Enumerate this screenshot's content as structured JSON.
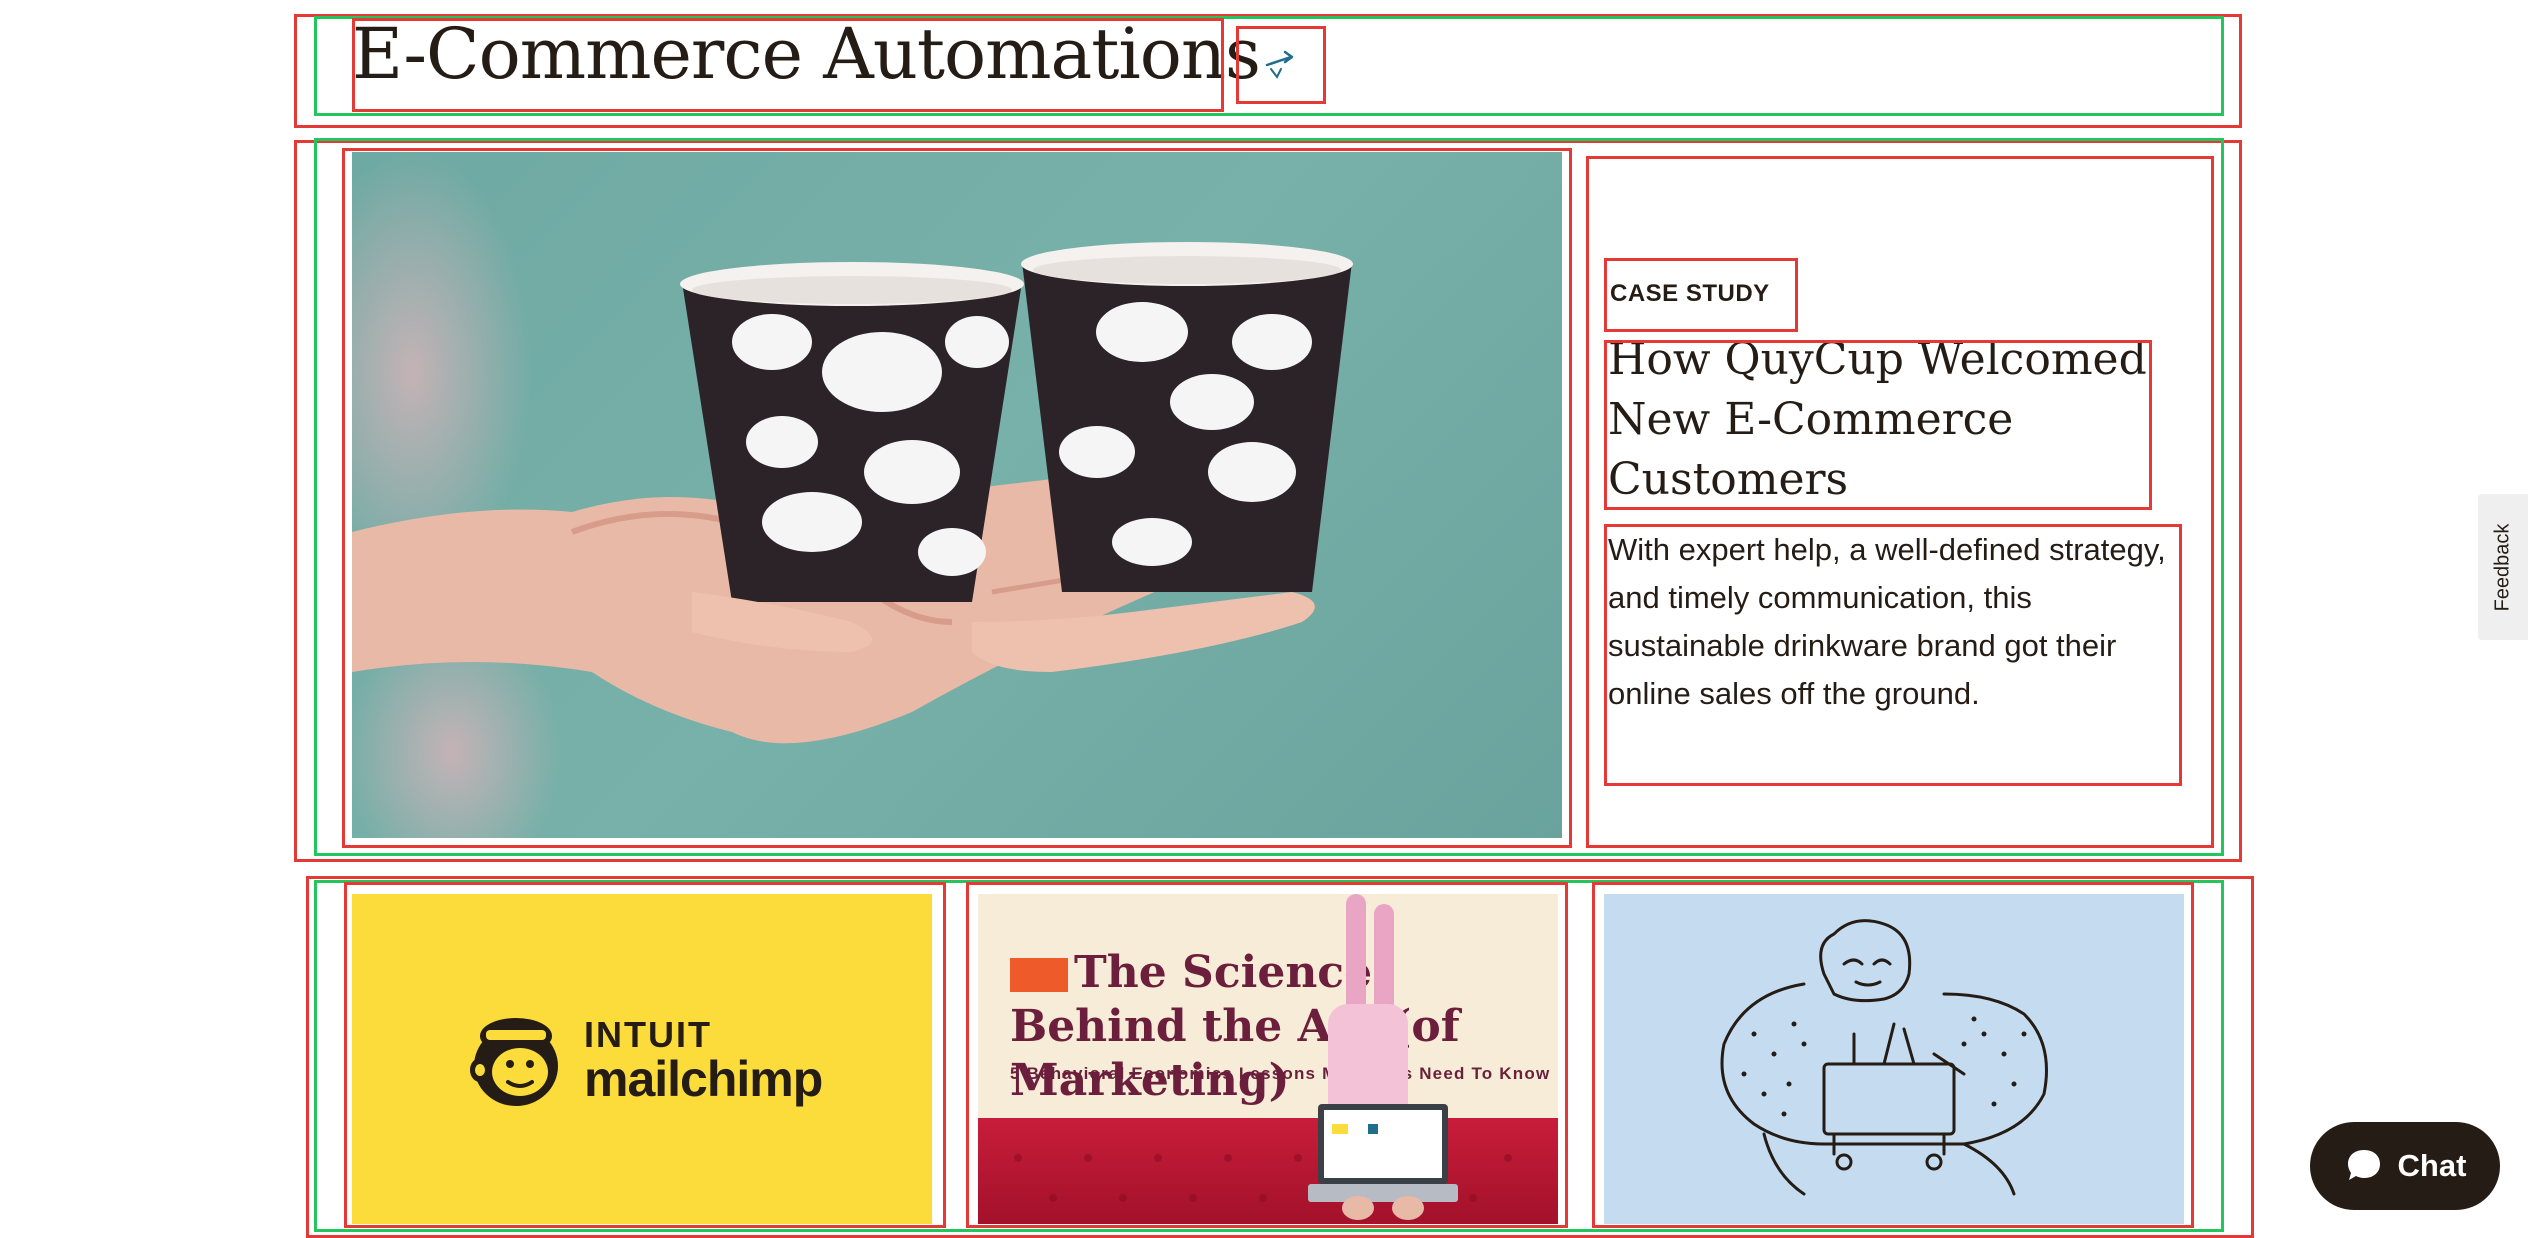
{
  "header": {
    "title": "E-Commerce Automations",
    "icon": "share-arrow-icon"
  },
  "feature": {
    "image_alt": "Two black cups with white clouds held in hands",
    "label": "CASE STUDY",
    "heading": "How QuyCup Welcomed New E-Commerce Customers",
    "description": "With expert help, a well-defined strategy, and timely communication, this sustainable drinkware brand got their online sales off the ground."
  },
  "cards": [
    {
      "logo_line1": "INTUIT",
      "logo_line2": "mailchimp",
      "background": "#fcdc3b"
    },
    {
      "title": "The Science Behind the Art (of Marketing)",
      "subtitle": "5 Behavioral Economics Lessons Marketers Need To Know",
      "background": "#f6ecd7"
    },
    {
      "illustration": "person-with-shopping-cart-illustration",
      "background": "#c5dcf0"
    }
  ],
  "feedback": {
    "label": "Feedback"
  },
  "chat": {
    "label": "Chat",
    "icon": "chat-bubble-icon"
  },
  "colors": {
    "text": "#241c15",
    "accent_red": "#e53935",
    "accent_green": "#22c55e",
    "teal": "#6fa9a3"
  }
}
